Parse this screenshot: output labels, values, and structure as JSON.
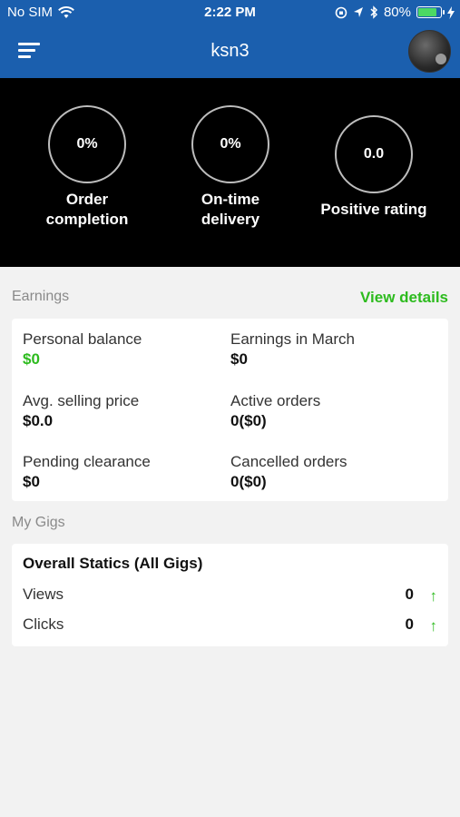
{
  "status_bar": {
    "carrier": "No SIM",
    "time": "2:22 PM",
    "battery": "80%",
    "battery_level": 0.8
  },
  "header": {
    "title": "ksn3"
  },
  "stats": [
    {
      "value": "0%",
      "label_line1": "Order",
      "label_line2": "completion"
    },
    {
      "value": "0%",
      "label_line1": "On-time",
      "label_line2": "delivery"
    },
    {
      "value": "0.0",
      "label_line1": "Positive rating",
      "label_line2": ""
    }
  ],
  "earnings": {
    "section_title": "Earnings",
    "view_details": "View details",
    "cells": [
      {
        "label": "Personal balance",
        "value": "$0"
      },
      {
        "label": "Earnings in March",
        "value": "$0"
      },
      {
        "label": "Avg. selling price",
        "value": "$0.0"
      },
      {
        "label": "Active orders",
        "value": "0($0)"
      },
      {
        "label": "Pending clearance",
        "value": "$0"
      },
      {
        "label": "Cancelled orders",
        "value": "0($0)"
      }
    ]
  },
  "gigs": {
    "section_title": "My Gigs",
    "card_title": "Overall Statics (All Gigs)",
    "rows": [
      {
        "label": "Views",
        "value": "0"
      },
      {
        "label": "Clicks",
        "value": "0"
      }
    ]
  },
  "colors": {
    "brand_blue": "#1b5fae",
    "accent_green": "#2dbb1e",
    "battery_green": "#4cd964"
  }
}
